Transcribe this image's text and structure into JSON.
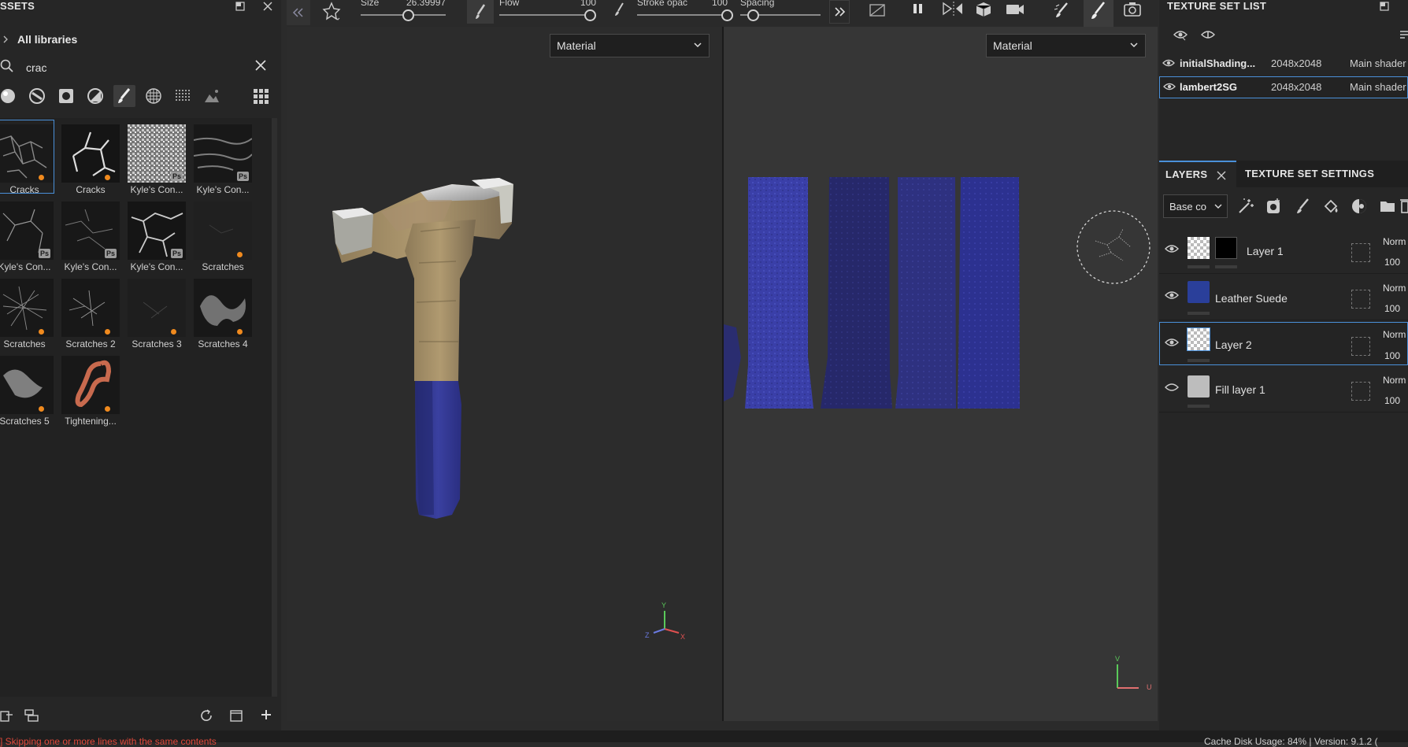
{
  "assets": {
    "title": "SSETS",
    "library_label": "All libraries",
    "search_value": "crac",
    "items": [
      {
        "label": "Cracks",
        "badge": "",
        "dot": true
      },
      {
        "label": "Cracks",
        "badge": "",
        "dot": true
      },
      {
        "label": "Kyle's Con...",
        "badge": "Ps",
        "dot": false
      },
      {
        "label": "Kyle's Con...",
        "badge": "Ps",
        "dot": false
      },
      {
        "label": "Kyle's Con...",
        "badge": "Ps",
        "dot": false
      },
      {
        "label": "Kyle's Con...",
        "badge": "Ps",
        "dot": false
      },
      {
        "label": "Kyle's Con...",
        "badge": "Ps",
        "dot": false
      },
      {
        "label": "Scratches",
        "badge": "",
        "dot": true
      },
      {
        "label": "Scratches",
        "badge": "",
        "dot": true
      },
      {
        "label": "Scratches 2",
        "badge": "",
        "dot": true
      },
      {
        "label": "Scratches 3",
        "badge": "",
        "dot": true
      },
      {
        "label": "Scratches 4",
        "badge": "",
        "dot": true
      },
      {
        "label": "Scratches 5",
        "badge": "",
        "dot": true
      },
      {
        "label": "Tightening...",
        "badge": "",
        "dot": true
      }
    ]
  },
  "toolbar": {
    "size_label": "Size",
    "size_value": "26.39997",
    "flow_label": "Flow",
    "flow_value": "100",
    "stroke_label": "Stroke opac",
    "stroke_value": "100",
    "spacing_label": "Spacing"
  },
  "viewport3d": {
    "material_label": "Material",
    "axis_y": "Y",
    "axis_z": "Z",
    "axis_x": "X"
  },
  "viewport2d": {
    "material_label": "Material",
    "axis_v": "V",
    "axis_u": "U"
  },
  "texture_set_list": {
    "title": "TEXTURE SET LIST",
    "rows": [
      {
        "name": "initialShading...",
        "resolution": "2048x2048",
        "shader": "Main shader"
      },
      {
        "name": "lambert2SG",
        "resolution": "2048x2048",
        "shader": "Main shader"
      }
    ]
  },
  "layers_panel": {
    "tab_layers": "LAYERS",
    "tab_settings": "TEXTURE SET SETTINGS",
    "channel_select": "Base co",
    "layers": [
      {
        "name": "Layer 1",
        "blend": "Norm",
        "opacity": "100"
      },
      {
        "name": "Leather Suede",
        "blend": "Norm",
        "opacity": "100"
      },
      {
        "name": "Layer 2",
        "blend": "Norm",
        "opacity": "100"
      },
      {
        "name": "Fill layer 1",
        "blend": "Norm",
        "opacity": "100"
      }
    ]
  },
  "status": {
    "message": "] Skipping one or more lines with the same contents",
    "cache": "Cache Disk Usage:  84%  |  Version: 9.1.2 (",
    "message_color": "#e0483a"
  }
}
